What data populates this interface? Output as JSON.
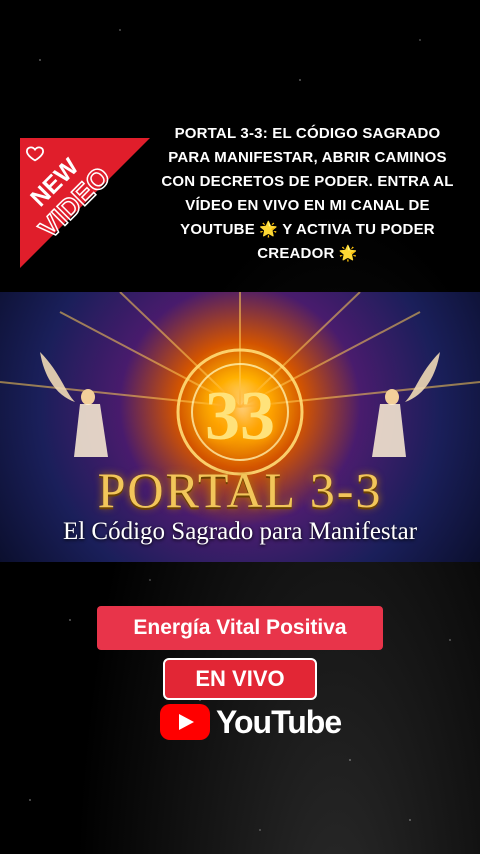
{
  "badge": {
    "line1": "NEW",
    "line2": "VIDEO",
    "heart": "heart-icon"
  },
  "headline": "PORTAL 3-3: EL CÓDIGO SAGRADO PARA MANIFESTAR, ABRIR CAMINOS CON DECRETOS DE PODER. ENTRA AL VÍDEO EN VIVO EN MI CANAL DE YOUTUBE 🌟 Y ACTIVA TU PODER CREADOR 🌟",
  "banner": {
    "number": "33",
    "title": "PORTAL 3-3",
    "subtitle": "El Código Sagrado para Manifestar"
  },
  "channel": "Energía Vital Positiva",
  "live": "EN VIVO",
  "youtube": "YouTube",
  "colors": {
    "accent_red": "#e8344a",
    "gold": "#f2c65a"
  }
}
